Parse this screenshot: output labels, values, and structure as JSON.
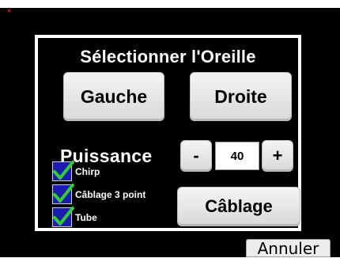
{
  "dialog": {
    "title": "Sélectionner l'Oreille"
  },
  "ear_buttons": {
    "left": "Gauche",
    "right": "Droite"
  },
  "power": {
    "label": "Puissance",
    "minus": "-",
    "value": "40",
    "plus": "+"
  },
  "options": [
    {
      "label": "Chirp",
      "checked": true
    },
    {
      "label": "Câblage 3 point",
      "checked": true
    },
    {
      "label": "Tube",
      "checked": true
    }
  ],
  "wiring_button": "Câblage",
  "cancel_button": "Annuler",
  "colors": {
    "background": "#000000",
    "checkbox": "#1c1cb0",
    "checkmark": "#33cc33"
  }
}
